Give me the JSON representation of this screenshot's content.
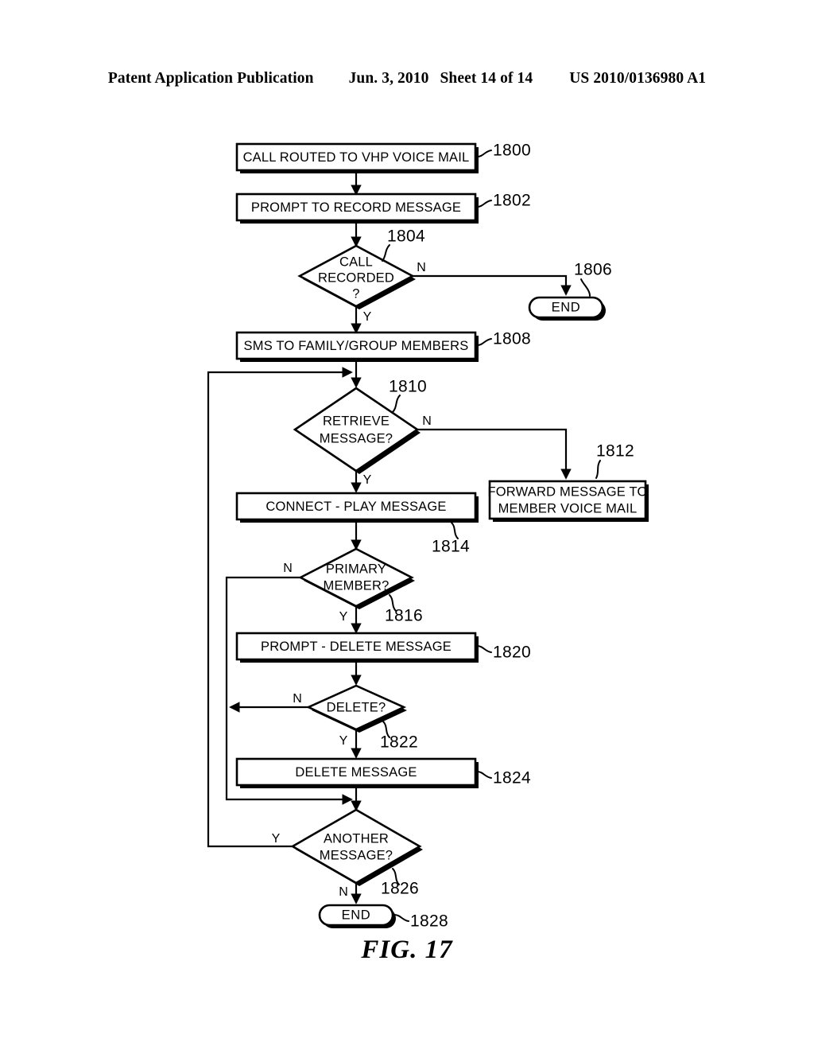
{
  "header": {
    "publication": "Patent Application Publication",
    "date": "Jun. 3, 2010",
    "sheet": "Sheet 14 of 14",
    "patent_number": "US 2010/0136980 A1"
  },
  "figure": {
    "caption": "FIG. 17"
  },
  "nodes": {
    "n1800": {
      "label": "CALL ROUTED TO VHP VOICE MAIL",
      "ref": "1800",
      "type": "process"
    },
    "n1802": {
      "label": "PROMPT TO RECORD MESSAGE",
      "ref": "1802",
      "type": "process"
    },
    "n1804": {
      "label_line1": "CALL",
      "label_line2": "RECORDED",
      "label_line3": "?",
      "ref": "1804",
      "type": "decision"
    },
    "n1806": {
      "label": "END",
      "ref": "1806",
      "type": "terminator"
    },
    "n1808": {
      "label": "SMS TO FAMILY/GROUP MEMBERS",
      "ref": "1808",
      "type": "process"
    },
    "n1810": {
      "label_line1": "RETRIEVE",
      "label_line2": "MESSAGE?",
      "ref": "1810",
      "type": "decision"
    },
    "n1812": {
      "label_line1": "FORWARD MESSAGE TO",
      "label_line2": "MEMBER VOICE MAIL",
      "ref": "1812",
      "type": "process"
    },
    "n1814": {
      "label": "CONNECT - PLAY MESSAGE",
      "ref": "1814",
      "type": "process"
    },
    "n1816": {
      "label_line1": "PRIMARY",
      "label_line2": "MEMBER?",
      "ref": "1816",
      "type": "decision"
    },
    "n1820": {
      "label": "PROMPT - DELETE MESSAGE",
      "ref": "1820",
      "type": "process"
    },
    "n1822": {
      "label": "DELETE?",
      "ref": "1822",
      "type": "decision"
    },
    "n1824": {
      "label": "DELETE MESSAGE",
      "ref": "1824",
      "type": "process"
    },
    "n1826": {
      "label_line1": "ANOTHER",
      "label_line2": "MESSAGE?",
      "ref": "1826",
      "type": "decision"
    },
    "n1828": {
      "label": "END",
      "ref": "1828",
      "type": "terminator"
    }
  },
  "branches": {
    "b1804_n": "N",
    "b1804_y": "Y",
    "b1810_n": "N",
    "b1810_y": "Y",
    "b1816_n": "N",
    "b1816_y": "Y",
    "b1822_n": "N",
    "b1822_y": "Y",
    "b1826_y": "Y",
    "b1826_n": "N"
  },
  "colors": {
    "ink": "#000000",
    "paper": "#ffffff"
  }
}
